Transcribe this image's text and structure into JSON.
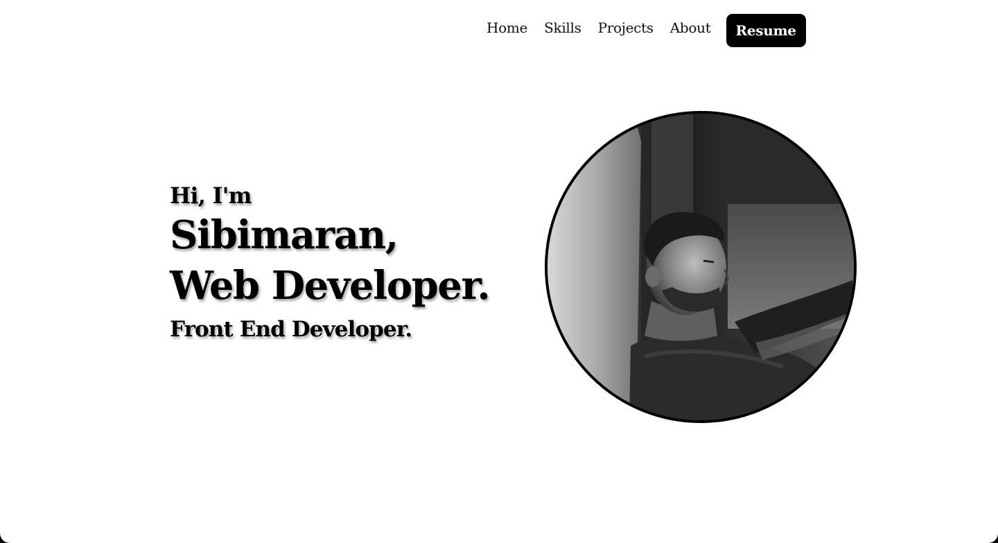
{
  "nav": {
    "links": [
      {
        "label": "Home"
      },
      {
        "label": "Skills"
      },
      {
        "label": "Projects"
      },
      {
        "label": "About"
      }
    ],
    "resume_label": "Resume"
  },
  "hero": {
    "greeting": "Hi, I'm",
    "name": "Sibimaran,",
    "role": "Web Developer.",
    "subrole": "Front End Developer."
  },
  "colors": {
    "background": "#ffffff",
    "text": "#000000",
    "button_bg": "#000000",
    "button_text": "#ffffff"
  },
  "portrait": {
    "icon": "profile-photo",
    "style": "grayscale"
  }
}
